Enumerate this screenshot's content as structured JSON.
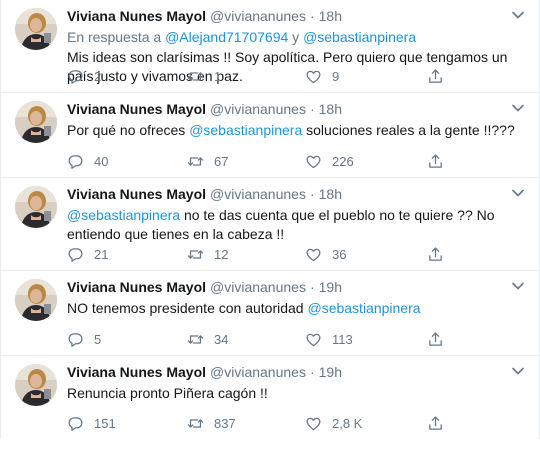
{
  "colors": {
    "accent": "#1b95e0",
    "muted": "#657786",
    "text": "#14171a",
    "border": "#e6ecf0"
  },
  "icons": {
    "reply": "reply-icon",
    "retweet": "retweet-icon",
    "like": "heart-icon",
    "share": "share-icon",
    "menu": "chevron-down-icon"
  },
  "tweets": [
    {
      "name": "Viviana Nunes Mayol",
      "handle": "@viviananunes",
      "dot": "·",
      "time": "18h",
      "reply_prefix": "En respuesta a",
      "reply_user1": "@Alejand71707694",
      "reply_join": "y",
      "reply_user2": "@sebastianpinera",
      "text_before": "Mis ideas son clarísimas !! Soy apolítica. Pero quiero que tengamos un país justo y vivamos en paz.",
      "replies": "2",
      "retweets": "1",
      "likes": "9"
    },
    {
      "name": "Viviana Nunes Mayol",
      "handle": "@viviananunes",
      "dot": "·",
      "time": "18h",
      "text_before": "Por qué no ofreces",
      "mention": "@sebastianpinera",
      "text_after": "soluciones reales a la gente !!???",
      "replies": "40",
      "retweets": "67",
      "likes": "226"
    },
    {
      "name": "Viviana Nunes Mayol",
      "handle": "@viviananunes",
      "dot": "·",
      "time": "18h",
      "mention": "@sebastianpinera",
      "text_after": "no te das cuenta que el pueblo no te quiere ?? No entiendo que tienes en la cabeza !!",
      "replies": "21",
      "retweets": "12",
      "likes": "36"
    },
    {
      "name": "Viviana Nunes Mayol",
      "handle": "@viviananunes",
      "dot": "·",
      "time": "19h",
      "text_before": "NO tenemos presidente con autoridad",
      "mention": "@sebastianpinera",
      "replies": "5",
      "retweets": "34",
      "likes": "113"
    },
    {
      "name": "Viviana Nunes Mayol",
      "handle": "@viviananunes",
      "dot": "·",
      "time": "19h",
      "text_before": "Renuncia pronto Piñera cagón !!",
      "replies": "151",
      "retweets": "837",
      "likes": "2,8 K"
    }
  ]
}
